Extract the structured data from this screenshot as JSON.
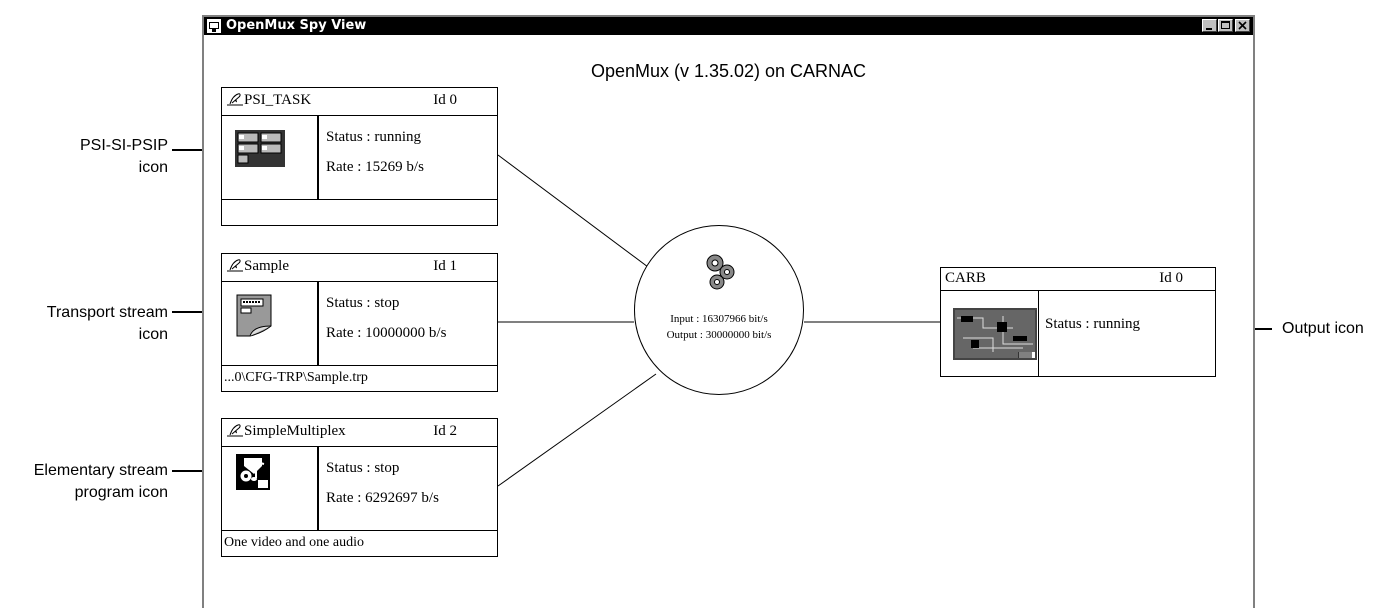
{
  "window": {
    "title": "OpenMux Spy View"
  },
  "heading": "OpenMux (v 1.35.02) on CARNAC",
  "callouts": {
    "psi_line1": "PSI-SI-PSIP",
    "psi_line2": "icon",
    "ts_line1": "Transport stream",
    "ts_line2": "icon",
    "es_line1": "Elementary stream",
    "es_line2": "program icon",
    "output": "Output icon"
  },
  "tasks": [
    {
      "name": "PSI_TASK",
      "id": "Id 0",
      "status": "Status : running",
      "rate": "Rate : 15269 b/s",
      "footer": "",
      "icon": "psi-si-psip-icon"
    },
    {
      "name": "Sample",
      "id": "Id 1",
      "status": "Status : stop",
      "rate": "Rate : 10000000 b/s",
      "footer": "...0\\CFG-TRP\\Sample.trp",
      "icon": "transport-stream-icon"
    },
    {
      "name": "SimpleMultiplex",
      "id": "Id 2",
      "status": "Status : stop",
      "rate": "Rate : 6292697 b/s",
      "footer": "One video and one audio",
      "icon": "elementary-stream-icon"
    }
  ],
  "hub": {
    "input": "Input : 16307966 bit/s",
    "output": "Output : 30000000 bit/s",
    "icon": "gears-icon"
  },
  "output_box": {
    "name": "CARB",
    "id": "Id 0",
    "status": "Status : running",
    "icon": "output-board-icon"
  },
  "colors": {
    "titlebar": "#000000",
    "window_border": "#808080",
    "button_face": "#c0c0c0"
  }
}
